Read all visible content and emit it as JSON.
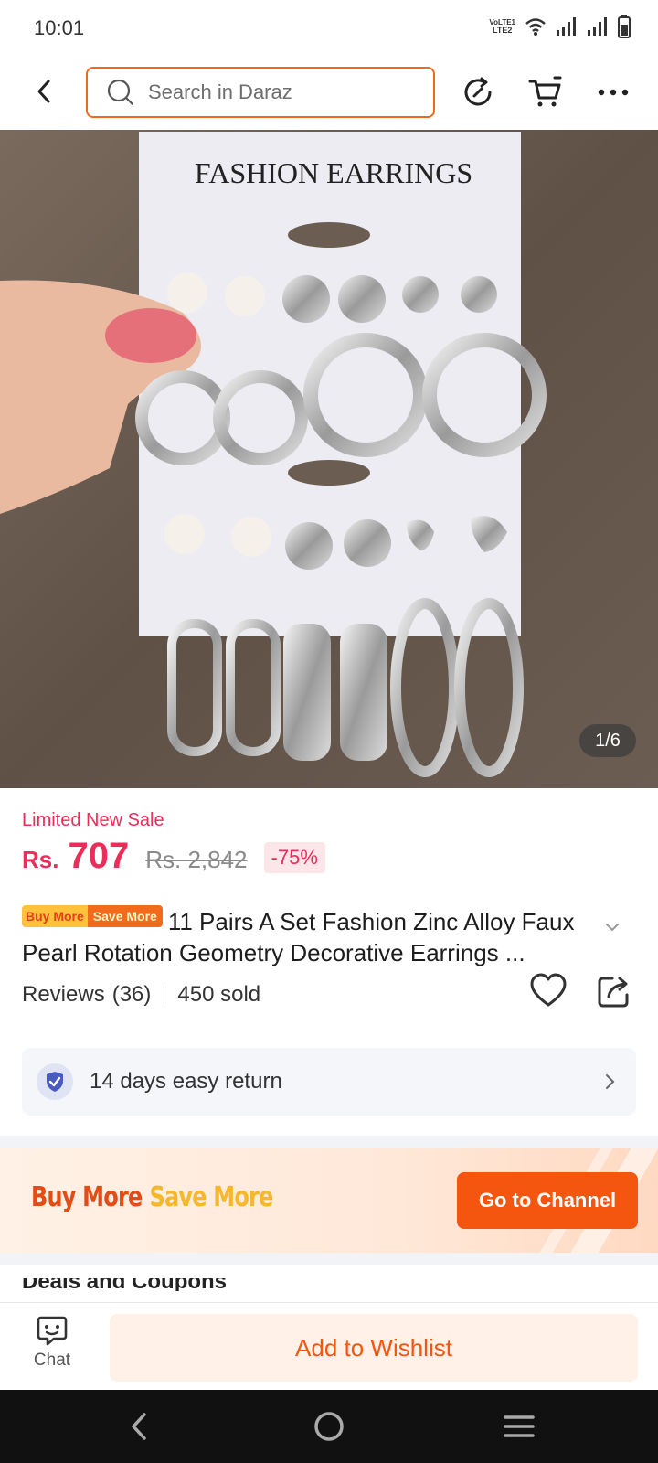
{
  "status_bar": {
    "time": "10:01",
    "network_label_top": "VoLTE1",
    "network_label_bottom": "LTE2",
    "icons": [
      "volte-icon",
      "wifi-icon",
      "signal-1-icon",
      "signal-2-icon",
      "battery-icon"
    ]
  },
  "top_nav": {
    "back_icon": "chevron-left-icon",
    "search_placeholder": "Search in Daraz",
    "icons": [
      "search-icon",
      "history-icon",
      "cart-icon",
      "more-icon"
    ]
  },
  "product_image": {
    "card_heading": "FASHION EARRINGS",
    "page_indicator": "1/6"
  },
  "pricing": {
    "sale_label": "Limited New Sale",
    "currency": "Rs.",
    "price": "707",
    "original_price": "Rs. 2,842",
    "discount": "-75%"
  },
  "product": {
    "badge_part1": "Buy More",
    "badge_part2": "Save More",
    "title": "11 Pairs A Set Fashion Zinc Alloy Faux Pearl Rotation Geometry Decorative Earrings ...",
    "reviews_label": "Reviews",
    "reviews_count": "(36)",
    "sold": "450 sold"
  },
  "return_policy": {
    "text": "14 days easy return"
  },
  "promo": {
    "part1": "Buy More",
    "part2": "Save More",
    "button": "Go to Channel"
  },
  "peek": {
    "text": "Deals and Coupons"
  },
  "bottom_bar": {
    "chat_label": "Chat",
    "wishlist_button": "Add to Wishlist"
  },
  "colors": {
    "accent": "#f5560f",
    "price": "#ee2c5a",
    "search_border": "#f06a1a"
  }
}
